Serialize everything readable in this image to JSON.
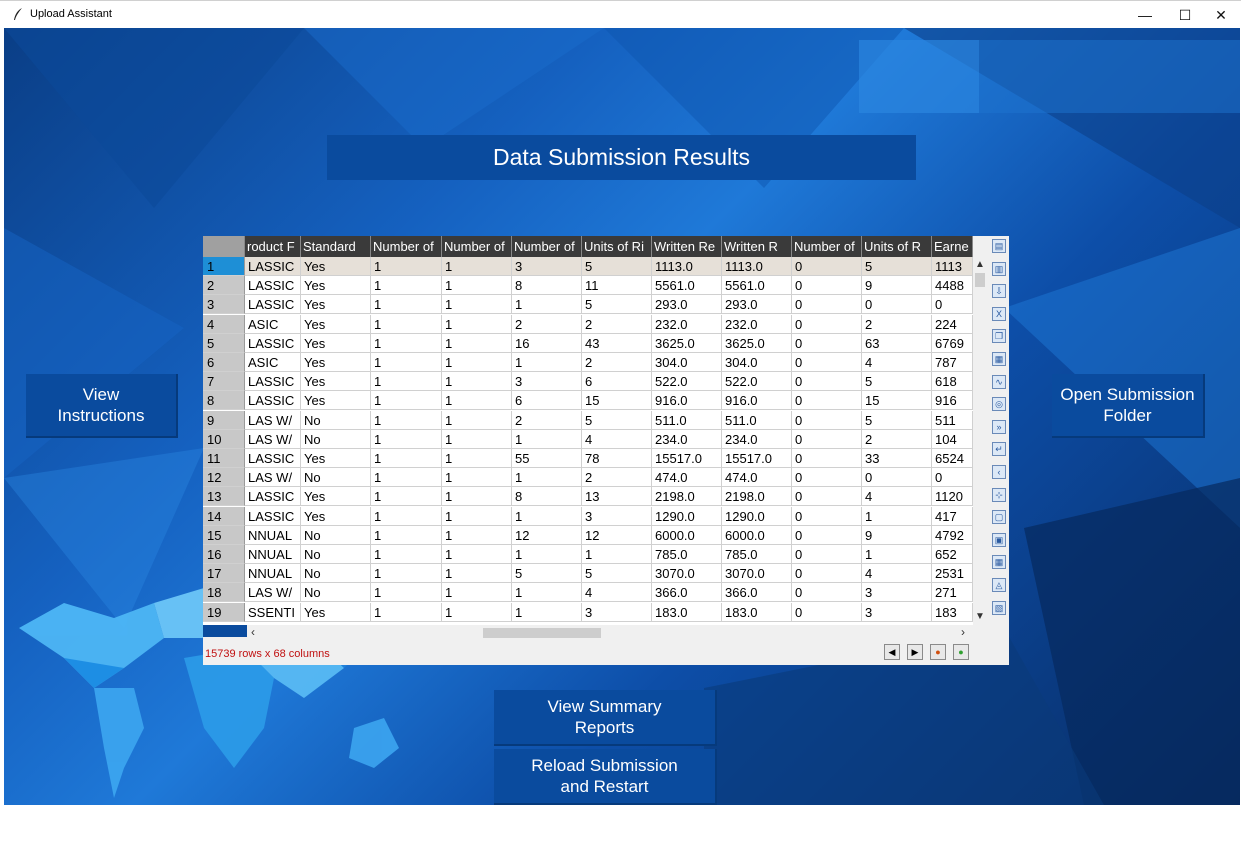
{
  "window": {
    "title": "Upload Assistant",
    "controls": {
      "minimize": "—",
      "maximize": "☐",
      "close": "✕"
    }
  },
  "header": {
    "title": "Data Submission Results"
  },
  "buttons": {
    "view_instructions": "View\nInstructions",
    "open_folder": "Open Submission\nFolder",
    "view_summary": "View Summary\nReports",
    "reload": "Reload Submission\nand Restart"
  },
  "table": {
    "columns": [
      "roduct F",
      "Standard",
      "Number of",
      "Number of",
      "Number of",
      "Units of Ri",
      "Written Re",
      "Written R",
      "Number of",
      "Units of R",
      "Earne"
    ],
    "rows": [
      [
        "1",
        "LASSIC",
        "Yes",
        "1",
        "1",
        "3",
        "5",
        "1113.0",
        "1113.0",
        "0",
        "5",
        "1113"
      ],
      [
        "2",
        "LASSIC",
        "Yes",
        "1",
        "1",
        "8",
        "11",
        "5561.0",
        "5561.0",
        "0",
        "9",
        "4488"
      ],
      [
        "3",
        "LASSIC",
        "Yes",
        "1",
        "1",
        "1",
        "5",
        "293.0",
        "293.0",
        "0",
        "0",
        "0"
      ],
      [
        "4",
        "ASIC",
        "Yes",
        "1",
        "1",
        "2",
        "2",
        "232.0",
        "232.0",
        "0",
        "2",
        "224"
      ],
      [
        "5",
        "LASSIC",
        "Yes",
        "1",
        "1",
        "16",
        "43",
        "3625.0",
        "3625.0",
        "0",
        "63",
        "6769"
      ],
      [
        "6",
        "ASIC",
        "Yes",
        "1",
        "1",
        "1",
        "2",
        "304.0",
        "304.0",
        "0",
        "4",
        "787"
      ],
      [
        "7",
        "LASSIC",
        "Yes",
        "1",
        "1",
        "3",
        "6",
        "522.0",
        "522.0",
        "0",
        "5",
        "618"
      ],
      [
        "8",
        "LASSIC",
        "Yes",
        "1",
        "1",
        "6",
        "15",
        "916.0",
        "916.0",
        "0",
        "15",
        "916"
      ],
      [
        "9",
        "LAS W/",
        "No",
        "1",
        "1",
        "2",
        "5",
        "511.0",
        "511.0",
        "0",
        "5",
        "511"
      ],
      [
        "10",
        "LAS W/",
        "No",
        "1",
        "1",
        "1",
        "4",
        "234.0",
        "234.0",
        "0",
        "2",
        "104"
      ],
      [
        "11",
        "LASSIC",
        "Yes",
        "1",
        "1",
        "55",
        "78",
        "15517.0",
        "15517.0",
        "0",
        "33",
        "6524"
      ],
      [
        "12",
        "LAS W/",
        "No",
        "1",
        "1",
        "1",
        "2",
        "474.0",
        "474.0",
        "0",
        "0",
        "0"
      ],
      [
        "13",
        "LASSIC",
        "Yes",
        "1",
        "1",
        "8",
        "13",
        "2198.0",
        "2198.0",
        "0",
        "4",
        "1120"
      ],
      [
        "14",
        "LASSIC",
        "Yes",
        "1",
        "1",
        "1",
        "3",
        "1290.0",
        "1290.0",
        "0",
        "1",
        "417"
      ],
      [
        "15",
        "NNUAL",
        "No",
        "1",
        "1",
        "12",
        "12",
        "6000.0",
        "6000.0",
        "0",
        "9",
        "4792"
      ],
      [
        "16",
        "NNUAL",
        "No",
        "1",
        "1",
        "1",
        "1",
        "785.0",
        "785.0",
        "0",
        "1",
        "652"
      ],
      [
        "17",
        "NNUAL",
        "No",
        "1",
        "1",
        "5",
        "5",
        "3070.0",
        "3070.0",
        "0",
        "4",
        "2531"
      ],
      [
        "18",
        "LAS W/",
        "No",
        "1",
        "1",
        "1",
        "4",
        "366.0",
        "366.0",
        "0",
        "3",
        "271"
      ],
      [
        "19",
        "SSENTI",
        "Yes",
        "1",
        "1",
        "1",
        "3",
        "183.0",
        "183.0",
        "0",
        "3",
        "183"
      ]
    ],
    "selected_row": "1",
    "status": "15739 rows x 68 columns"
  },
  "colors": {
    "accent": "#0a4b9e",
    "selected_row_number": "#1e8fd6",
    "status_text": "#c01010"
  }
}
